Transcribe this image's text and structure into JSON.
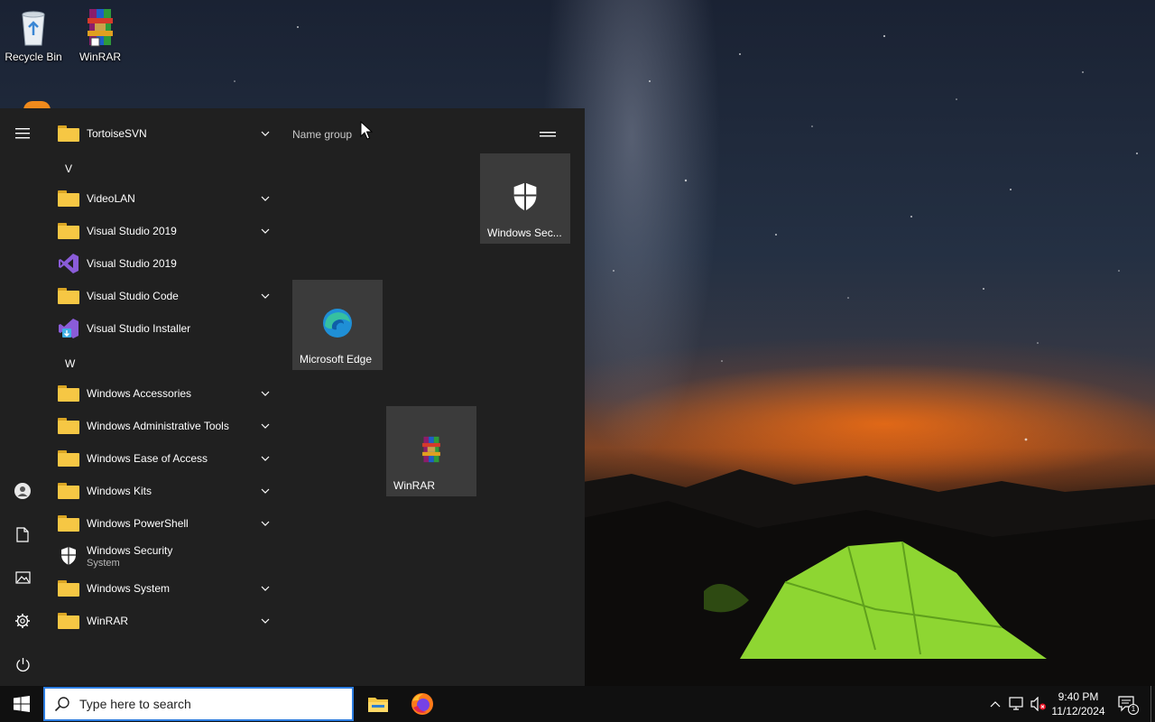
{
  "desktop": {
    "icons": [
      {
        "label": "Recycle Bin",
        "icon": "recycle-bin-icon"
      },
      {
        "label": "WinRAR",
        "icon": "winrar-icon"
      }
    ]
  },
  "start_menu": {
    "rail": [
      "hamburger-icon",
      "user-icon",
      "documents-icon",
      "pictures-icon",
      "settings-icon",
      "power-icon"
    ],
    "apps": [
      {
        "name": "TortoiseSVN",
        "type": "folder",
        "expandable": true
      },
      {
        "header": "V"
      },
      {
        "name": "VideoLAN",
        "type": "folder",
        "expandable": true
      },
      {
        "name": "Visual Studio 2019",
        "type": "folder",
        "expandable": true
      },
      {
        "name": "Visual Studio 2019",
        "type": "vs-icon",
        "expandable": false
      },
      {
        "name": "Visual Studio Code",
        "type": "folder",
        "expandable": true
      },
      {
        "name": "Visual Studio Installer",
        "type": "vs-installer-icon",
        "expandable": false
      },
      {
        "header": "W"
      },
      {
        "name": "Windows Accessories",
        "type": "folder",
        "expandable": true
      },
      {
        "name": "Windows Administrative Tools",
        "type": "folder",
        "expandable": true
      },
      {
        "name": "Windows Ease of Access",
        "type": "folder",
        "expandable": true
      },
      {
        "name": "Windows Kits",
        "type": "folder",
        "expandable": true
      },
      {
        "name": "Windows PowerShell",
        "type": "folder",
        "expandable": true
      },
      {
        "name": "Windows Security",
        "subtitle": "System",
        "type": "shield-icon",
        "expandable": false
      },
      {
        "name": "Windows System",
        "type": "folder",
        "expandable": true
      },
      {
        "name": "WinRAR",
        "type": "folder",
        "expandable": true
      }
    ],
    "tiles_group": {
      "name": "Name group",
      "tiles": [
        {
          "label": "Windows Sec...",
          "icon": "shield-icon"
        },
        {
          "label": "Microsoft Edge",
          "icon": "edge-icon"
        },
        {
          "label": "WinRAR",
          "icon": "winrar-icon"
        }
      ]
    }
  },
  "taskbar": {
    "search_placeholder": "Type here to search",
    "pinned": [
      "file-explorer-icon",
      "firefox-icon"
    ],
    "clock_time": "9:40 PM",
    "clock_date": "11/12/2024",
    "notification_count": "1"
  },
  "colors": {
    "start_bg": "#202020",
    "tile_bg": "#3b3b3b",
    "folder": "#f6c744",
    "accent": "#2d7de0"
  }
}
